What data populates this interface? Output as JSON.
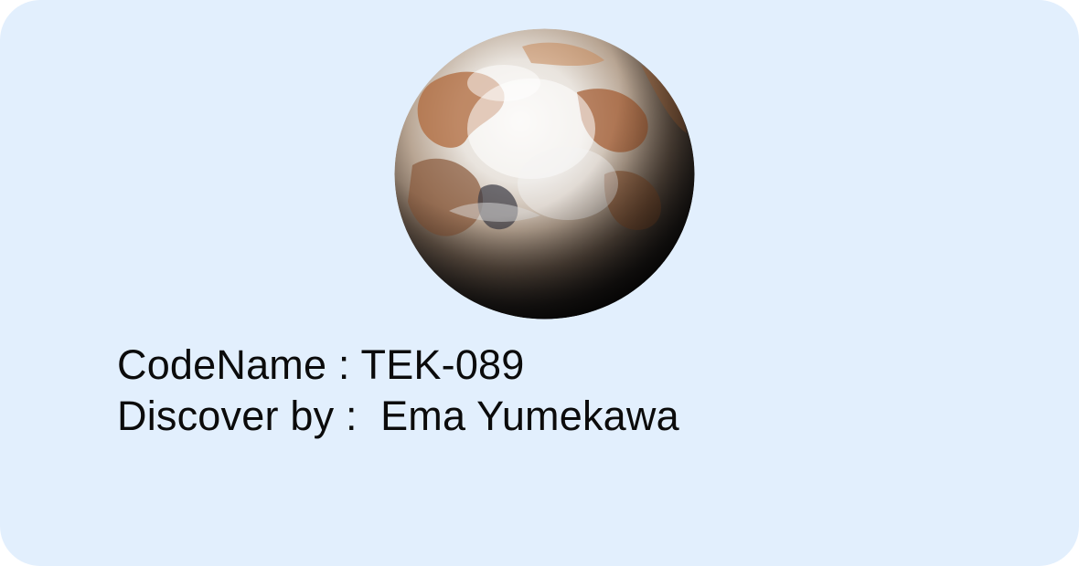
{
  "card": {
    "background": "#e2effd",
    "planet_icon": "planet-image",
    "codename_label": "CodeName : ",
    "codename_value": "TEK-089",
    "discoverer_label": "Discover by :  ",
    "discoverer_value": "Ema Yumekawa"
  }
}
